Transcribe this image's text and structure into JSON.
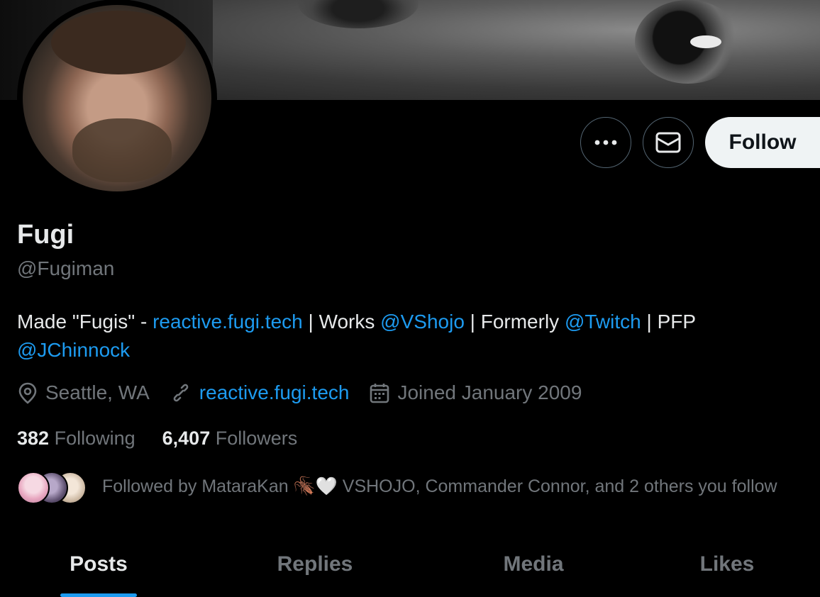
{
  "profile": {
    "name": "Fugi",
    "handle": "@Fugiman"
  },
  "actions": {
    "more_icon": "ellipsis-icon",
    "message_icon": "envelope-icon",
    "follow_label": "Follow"
  },
  "bio": {
    "t1": "Made \"Fugis\" - ",
    "link1": "reactive.fugi.tech",
    "t2": " | Works ",
    "mention1": "@VShojo",
    "t3": " | Formerly ",
    "mention2": "@Twitch",
    "t4": " | PFP ",
    "mention3": "@JChinnock"
  },
  "meta": {
    "location": "Seattle, WA",
    "website": "reactive.fugi.tech",
    "joined": "Joined January 2009"
  },
  "counts": {
    "following_num": "382",
    "following_label": "Following",
    "followers_num": "6,407",
    "followers_label": "Followers"
  },
  "followed_by": {
    "text": "Followed by MataraKan 🪳🤍 VSHOJO, Commander Connor, and 2 others you follow"
  },
  "tabs": [
    {
      "label": "Posts",
      "active": true
    },
    {
      "label": "Replies",
      "active": false
    },
    {
      "label": "Media",
      "active": false
    },
    {
      "label": "Likes",
      "active": false
    }
  ],
  "colors": {
    "accent": "#1d9bf0",
    "text": "#e7e9ea",
    "muted": "#71767b",
    "background": "#000000",
    "follow_bg": "#eff3f4"
  }
}
